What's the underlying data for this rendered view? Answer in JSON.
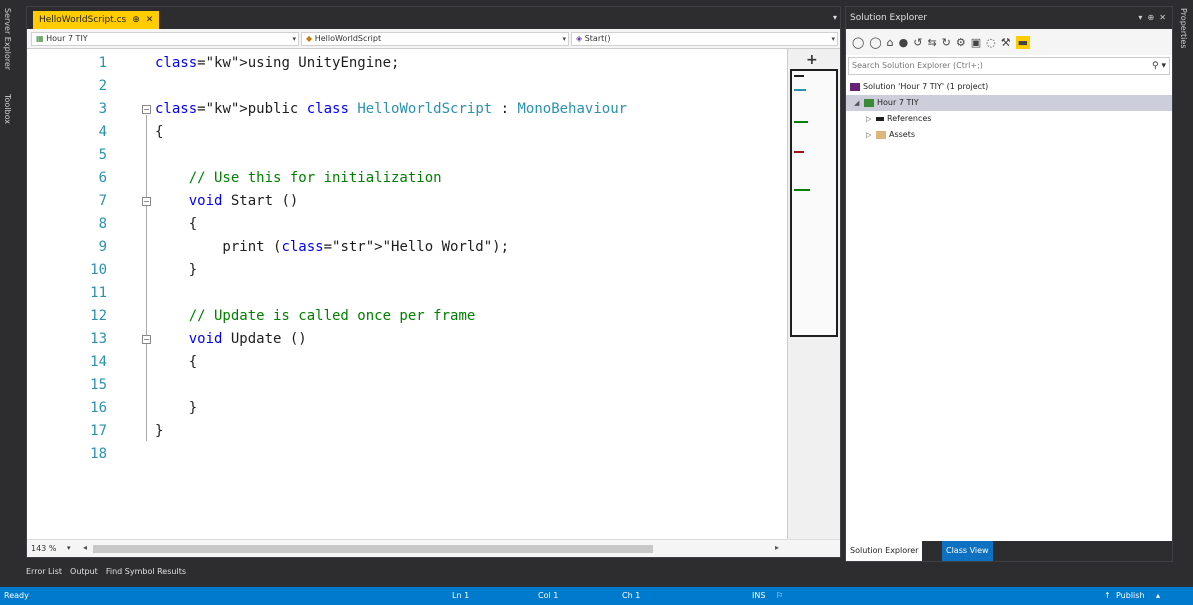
{
  "left_strip": {
    "tabs": [
      "Server Explorer",
      "Toolbox"
    ]
  },
  "right_strip": {
    "tabs": [
      "Properties"
    ]
  },
  "editor": {
    "file_tab": "HelloWorldScript.cs",
    "nav": {
      "project": "Hour 7 TIY",
      "class": "HelloWorldScript",
      "member": "Start()"
    },
    "lines": [
      {
        "n": "1",
        "html": "using UnityEngine;"
      },
      {
        "n": "2",
        "html": ""
      },
      {
        "n": "3",
        "html": "public class HelloWorldScript : MonoBehaviour"
      },
      {
        "n": "4",
        "html": "{"
      },
      {
        "n": "5",
        "html": ""
      },
      {
        "n": "6",
        "html": "    // Use this for initialization"
      },
      {
        "n": "7",
        "html": "    void Start ()"
      },
      {
        "n": "8",
        "html": "    {"
      },
      {
        "n": "9",
        "html": "        print (\"Hello World\");"
      },
      {
        "n": "10",
        "html": "    }"
      },
      {
        "n": "11",
        "html": ""
      },
      {
        "n": "12",
        "html": "    // Update is called once per frame"
      },
      {
        "n": "13",
        "html": "    void Update ()"
      },
      {
        "n": "14",
        "html": "    {"
      },
      {
        "n": "15",
        "html": ""
      },
      {
        "n": "16",
        "html": "    }"
      },
      {
        "n": "17",
        "html": "}"
      },
      {
        "n": "18",
        "html": ""
      }
    ],
    "zoom": "143 %"
  },
  "bottom_tabs": [
    "Error List",
    "Output",
    "Find Symbol Results"
  ],
  "solution_explorer": {
    "title": "Solution Explorer",
    "search_placeholder": "Search Solution Explorer (Ctrl+;)",
    "tree": [
      {
        "label": "Solution 'Hour 7 TIY' (1 project)",
        "indent": 0,
        "arrow": ""
      },
      {
        "label": "Hour 7 TIY",
        "indent": 1,
        "arrow": "◢",
        "selected": true
      },
      {
        "label": "References",
        "indent": 2,
        "arrow": "▷"
      },
      {
        "label": "Assets",
        "indent": 2,
        "arrow": "▷"
      }
    ],
    "tabs": [
      "Solution Explorer",
      "Class View"
    ]
  },
  "status": {
    "ready": "Ready",
    "ln": "Ln 1",
    "col": "Col 1",
    "ch": "Ch 1",
    "ins": "INS",
    "publish": "Publish"
  },
  "colors": {
    "accent": "#007acc",
    "tab_active": "#ffcc00",
    "keyword": "#0000ff",
    "type": "#2b91af",
    "comment": "#008000",
    "string": "#a31515"
  }
}
